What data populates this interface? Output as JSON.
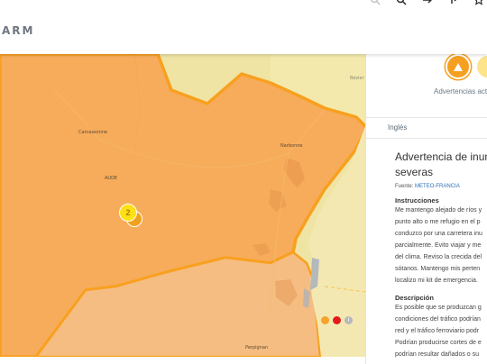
{
  "header": {
    "brand": "ARM",
    "icons": [
      "search-icon",
      "zoom-icon",
      "forward-icon",
      "share-icon",
      "star-icon"
    ]
  },
  "map": {
    "labels": {
      "carcassonne": "Carcassonne",
      "aude": "AUDE",
      "narbonne": "Narbonne",
      "beziers": "Bézier",
      "perpignan": "Perpignan"
    },
    "marker_count": "2",
    "legend_colors": [
      "#f7a32a",
      "#e31b1b"
    ],
    "legend_info": "i"
  },
  "panel": {
    "warnings_heading": "Advertencias acti",
    "language": "Inglés",
    "title_lines": [
      "Advertencia de inund",
      "severas"
    ],
    "source_label": "Fuente:",
    "source_value": "METEO-FRANCIA",
    "instructions_title": "Instrucciones",
    "instructions_lines": [
      "Me mantengo alejado de ríos y",
      "punto alto o me refugio en el p",
      "conduzco por una carretera inu",
      "parcialmente. Evito viajar y me",
      "del clima. Reviso la crecida del",
      "sótanos. Mantengo mis perten",
      "localizo mi kit de emergencia."
    ],
    "description_title": "Descripción",
    "description_lines": [
      "Es posible que se produzcan g",
      "condiciones del tráfico podrían",
      "red y el tráfico ferroviario podr",
      "Podrían producirse cortes de e",
      "podrían resultar dañados o su"
    ],
    "colors": {
      "accent": "#f5a020",
      "secondary": "#fde38a"
    }
  }
}
